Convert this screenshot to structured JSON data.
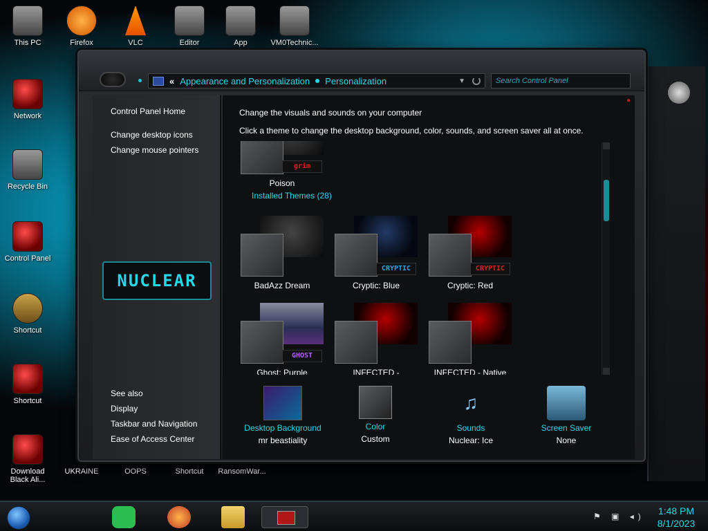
{
  "desktop": {
    "icons": [
      {
        "label": "This PC"
      },
      {
        "label": "Firefox"
      },
      {
        "label": "VLC"
      },
      {
        "label": "Editor"
      },
      {
        "label": "App"
      },
      {
        "label": "VM0Technic..."
      },
      {
        "label": "Network"
      },
      {
        "label": "Recycle Bin"
      },
      {
        "label": "Control Panel"
      },
      {
        "label": "Shortcut"
      },
      {
        "label": "Shortcut"
      },
      {
        "label": "Download Black Ali..."
      },
      {
        "label": "UKRAINE"
      },
      {
        "label": "OOPS"
      },
      {
        "label": "Shortcut"
      },
      {
        "label": "RansomWar..."
      }
    ]
  },
  "window": {
    "address": {
      "chevron": "«",
      "crumb1": "Appearance and Personalization",
      "crumb2": "Personalization"
    },
    "search": {
      "placeholder": "Search Control Panel"
    },
    "sidebar": {
      "home": "Control Panel Home",
      "links": [
        "Change desktop icons",
        "Change mouse pointers"
      ],
      "logo": "NUCLEAR",
      "see_also": "See also",
      "bottom_links": [
        "Display",
        "Taskbar and Navigation",
        "Ease of Access Center"
      ]
    },
    "heading": "Change the visuals and sounds on your computer",
    "subheading": "Click a theme to change the desktop background, color, sounds, and screen saver all at once.",
    "themes": {
      "top_theme": {
        "name": "Poison",
        "badge": "grim"
      },
      "installed_label": "Installed Themes (28)",
      "items": [
        {
          "name": "BadAzz Dream",
          "badge": ""
        },
        {
          "name": "Cryptic: Blue",
          "badge": "CRYPTIC"
        },
        {
          "name": "Cryptic: Red",
          "badge": "CRYPTIC"
        },
        {
          "name": "Ghost: Purple",
          "badge": "GHOST"
        },
        {
          "name": "INFECTED -",
          "badge": ""
        },
        {
          "name": "INFECTED - Native",
          "badge": ""
        }
      ]
    },
    "bottom": {
      "desktop_background": {
        "title": "Desktop Background",
        "value": "mr beastiality"
      },
      "color": {
        "title": "Color",
        "value": "Custom"
      },
      "sounds": {
        "title": "Sounds",
        "value": "Nuclear: Ice"
      },
      "screen_saver": {
        "title": "Screen Saver",
        "value": "None"
      }
    }
  },
  "taskbar": {
    "time": "1:48 PM",
    "date": "8/1/2023"
  },
  "colors": {
    "accent": "#25d7e8",
    "alert": "#e02020"
  }
}
